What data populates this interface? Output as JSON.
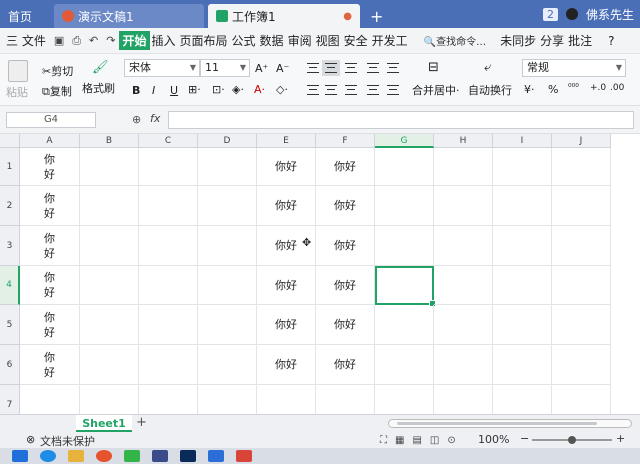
{
  "titlebar": {
    "tabs": [
      {
        "label": "首页"
      },
      {
        "label": "演示文稿1"
      },
      {
        "label": "工作簿1"
      }
    ],
    "new_tab": "+",
    "badge": "2",
    "user": "佛系先生"
  },
  "menubar": {
    "file": "三 文件",
    "items": [
      "开始",
      "插入",
      "页面布局",
      "公式",
      "数据",
      "审阅",
      "视图",
      "安全",
      "开发工"
    ],
    "search": "查找命令…",
    "sync": "未同步",
    "share": "分享",
    "comment": "批注",
    "help": "?"
  },
  "ribbon": {
    "paste": "粘贴",
    "cut": "剪切",
    "copy": "复制",
    "format_painter": "格式刷",
    "font_name": "宋体",
    "font_size": "11",
    "bold": "B",
    "italic": "I",
    "underline": "U",
    "font_grow": "A⁺",
    "font_shrink": "A⁻",
    "merge_center": "合并居中·",
    "wrap_text": "自动换行",
    "number_format": "常规",
    "currency": "¥·",
    "percent": "%"
  },
  "formula_bar": {
    "cell_ref": "G4",
    "fx": "fx",
    "value": ""
  },
  "sheet": {
    "columns": [
      "A",
      "B",
      "C",
      "D",
      "E",
      "F",
      "G",
      "H",
      "I",
      "J"
    ],
    "rows": [
      "1",
      "2",
      "3",
      "4",
      "5",
      "6",
      "7"
    ],
    "cells": {
      "A1": "你\n好",
      "A2": "你\n好",
      "A3": "你\n好",
      "A4": "你\n好",
      "A5": "你\n好",
      "A6": "你\n好",
      "E1": "你好",
      "E2": "你好",
      "E3": "你好",
      "E4": "你好",
      "E5": "你好",
      "E6": "你好",
      "F1": "你好",
      "F2": "你好",
      "F3": "你好",
      "F4": "你好",
      "F5": "你好",
      "F6": "你好"
    },
    "selected_cell": "G4"
  },
  "sheet_tabs": {
    "tabs": [
      "Sheet1"
    ],
    "add": "+"
  },
  "status": {
    "protection": "文档未保护",
    "zoom": "100%",
    "zoom_minus": "−",
    "zoom_plus": "+"
  }
}
